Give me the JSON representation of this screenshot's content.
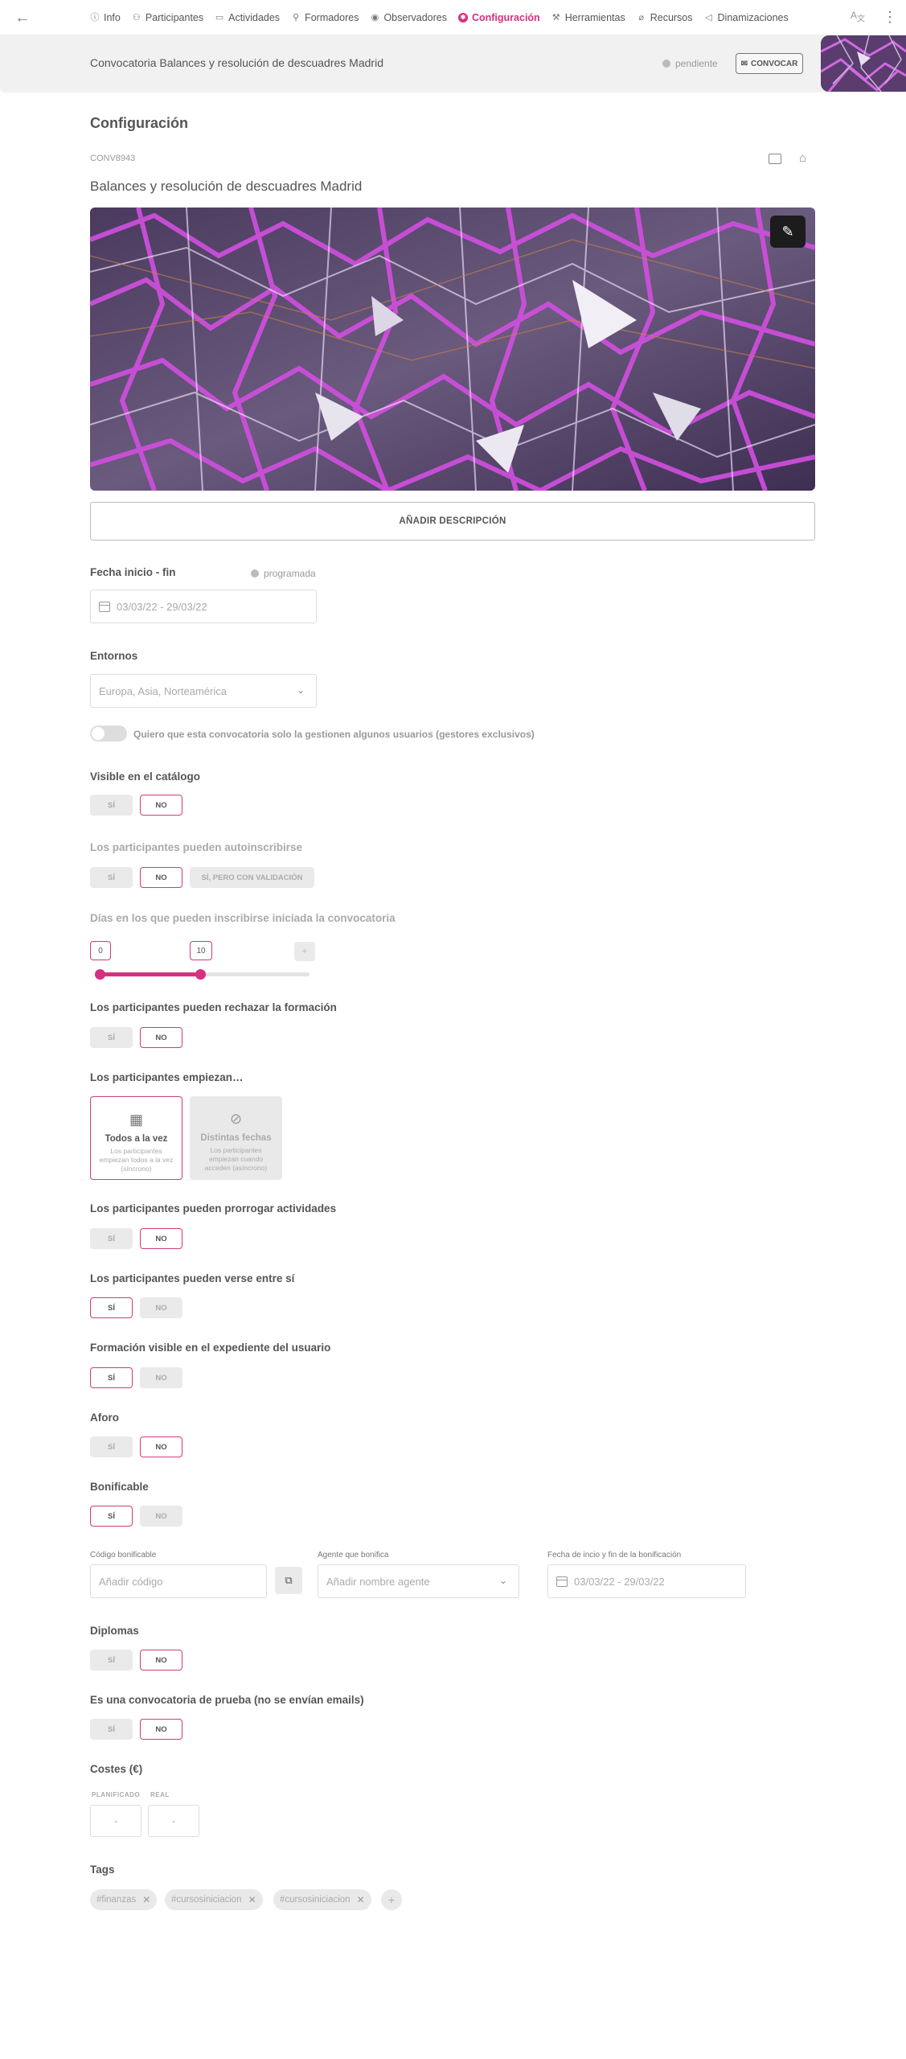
{
  "nav": {
    "back_icon": "arrow-left-icon",
    "tabs": [
      {
        "label": "Info",
        "icon": "info-icon"
      },
      {
        "label": "Participantes",
        "icon": "users-icon"
      },
      {
        "label": "Actividades",
        "icon": "monitor-icon"
      },
      {
        "label": "Formadores",
        "icon": "trainer-icon"
      },
      {
        "label": "Observadores",
        "icon": "eye-icon"
      },
      {
        "label": "Configuración",
        "icon": "gear-icon",
        "active": true
      },
      {
        "label": "Herramientas",
        "icon": "tools-icon"
      },
      {
        "label": "Recursos",
        "icon": "paperclip-icon"
      },
      {
        "label": "Dinamizaciones",
        "icon": "megaphone-icon"
      }
    ],
    "translate_icon": "translate-icon",
    "menu_icon": "kebab-icon"
  },
  "header": {
    "title": "Convocatoria Balances y resolución de descuadres Madrid",
    "status": "pendiente",
    "convocar_label": "CONVOCAR"
  },
  "config": {
    "heading": "Configuración",
    "code": "CONV8943",
    "subtitle": "Balances y resolución de descuadres Madrid",
    "add_description": "AÑADIR DESCRIPCIÓN"
  },
  "dates": {
    "label": "Fecha inicio - fin",
    "status": "programada",
    "value": "03/03/22 - 29/03/22"
  },
  "entornos": {
    "label": "Entornos",
    "value": "Europa, Asia, Norteamérica"
  },
  "exclusive_toggle": "Quiero que esta convocatoria solo la gestionen algunos  usuarios (gestores exclusivos)",
  "questions": {
    "visible_catalogo": "Visible en el catálogo",
    "autoinscribirse": "Los participantes pueden autoinscribirse",
    "dias_inscribirse": "Días en los que pueden inscribirse iniciada la convocatoria",
    "rechazar": "Los participantes pueden rechazar la formación",
    "empiezan": "Los participantes empiezan…",
    "prorrogar": "Los participantes pueden prorrogar actividades",
    "verse": "Los participantes pueden verse entre sí",
    "expediente": "Formación visible en el expediente del usuario",
    "aforo": "Aforo",
    "bonificable": "Bonificable",
    "diplomas": "Diplomas",
    "prueba": "Es una convocatoria de prueba (no se envían emails)",
    "costes": "Costes (€)",
    "tags": "Tags"
  },
  "options": {
    "si": "SÍ",
    "no": "NO",
    "si_validacion": "SÍ, PERO CON VALIDACIÓN"
  },
  "slider": {
    "min": "0",
    "max": "10",
    "plus": "+",
    "fraction": 0.48
  },
  "start_cards": [
    {
      "title": "Todos a la vez",
      "desc": "Los participantes empiezan todos a la vez (síncrono)",
      "icon": "calendar-icon"
    },
    {
      "title": "Distintas fechas",
      "desc": "Los participantes empiezan cuando acceden (asíncrono)",
      "icon": "calendar-off-icon"
    }
  ],
  "bonificacion": {
    "codigo_label": "Código bonificable",
    "codigo_placeholder": "Añadir código",
    "agente_label": "Agente que bonifica",
    "agente_placeholder": "Añadir nombre agente",
    "fechas_label": "Fecha de incio y fin de la bonificación",
    "fechas_value": "03/03/22 - 29/03/22"
  },
  "costes": {
    "planificado_label": "PLANIFICADO",
    "real_label": "REAL",
    "planificado": "-",
    "real": "-"
  },
  "tags": [
    "#finanzas",
    "#cursosiniciacion",
    "#cursosiniciacion"
  ],
  "colors": {
    "accent": "#d6307f",
    "header_bg": "#f1f1f1"
  }
}
